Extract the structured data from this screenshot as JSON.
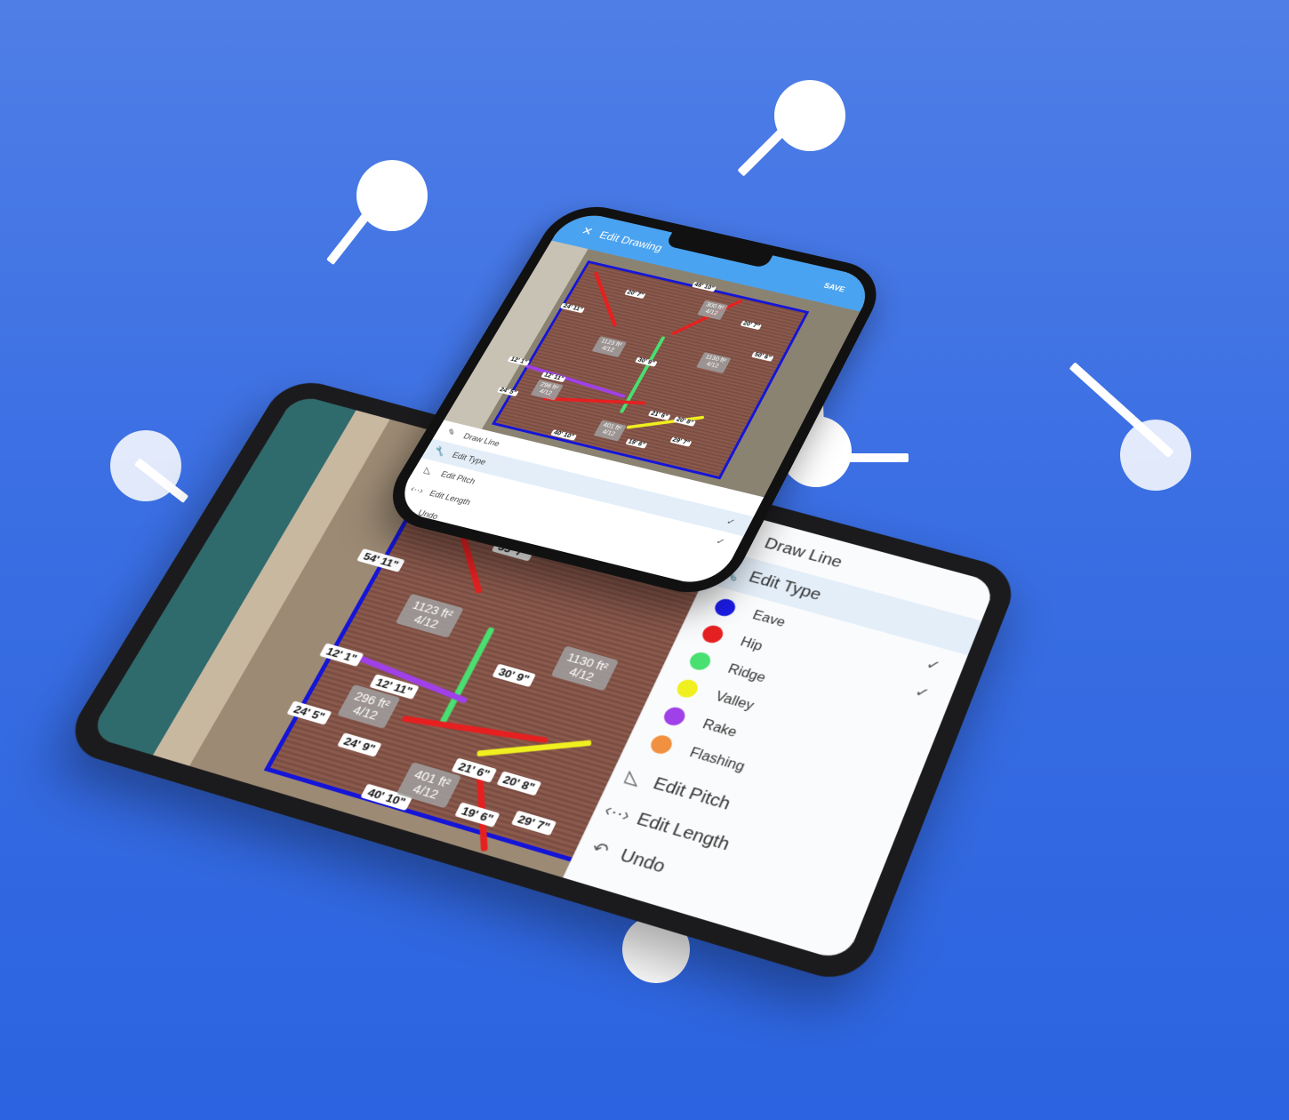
{
  "tablet": {
    "labels": [
      "35' 7\"",
      "54' 11\"",
      "12' 1\"",
      "12' 11\"",
      "30' 9\"",
      "24' 5\"",
      "24' 9\"",
      "21' 6\"",
      "20' 8\"",
      "29' 7\"",
      "19' 6\"",
      "40' 10\""
    ],
    "areas": [
      {
        "value": "1123 ft²",
        "pitch": "4/12"
      },
      {
        "value": "296 ft²",
        "pitch": "4/12"
      },
      {
        "value": "401 ft²",
        "pitch": "4/12"
      },
      {
        "value": "1130 ft²",
        "pitch": "4/12"
      }
    ],
    "panel": {
      "draw_line": "Draw Line",
      "edit_type": "Edit Type",
      "types": [
        {
          "label": "Eave",
          "color": "#1a1ae6",
          "checked": true
        },
        {
          "label": "Hip",
          "color": "#e62020",
          "checked": true
        },
        {
          "label": "Ridge",
          "color": "#48e070",
          "checked": false
        },
        {
          "label": "Valley",
          "color": "#f0f020",
          "checked": false
        },
        {
          "label": "Rake",
          "color": "#a040e8",
          "checked": false
        },
        {
          "label": "Flashing",
          "color": "#f09040",
          "checked": false
        }
      ],
      "edit_pitch": "Edit Pitch",
      "edit_length": "Edit Length",
      "undo": "Undo"
    }
  },
  "phone": {
    "header": {
      "close": "✕",
      "title": "Edit Drawing",
      "save": "SAVE"
    },
    "labels": [
      "48' 10\"",
      "20' 7\"",
      "20' 7\"",
      "24' 11\"",
      "50' 6\"",
      "12' 1\"",
      "12' 11\"",
      "30' 9\"",
      "21' 6\"",
      "20' 8\"",
      "24' 5\"",
      "29' 7\"",
      "19' 6\"",
      "40' 10\""
    ],
    "areas": [
      {
        "value": "300 ft²",
        "pitch": "4/12"
      },
      {
        "value": "1123 ft²",
        "pitch": "4/12"
      },
      {
        "value": "1130 ft²",
        "pitch": "4/12"
      },
      {
        "value": "296 ft²",
        "pitch": "4/12"
      },
      {
        "value": "401 ft²",
        "pitch": "4/12"
      }
    ],
    "menu": {
      "draw_line": "Draw Line",
      "edit_type": "Edit Type",
      "edit_pitch": "Edit Pitch",
      "edit_length": "Edit Length",
      "undo": "Undo"
    }
  }
}
